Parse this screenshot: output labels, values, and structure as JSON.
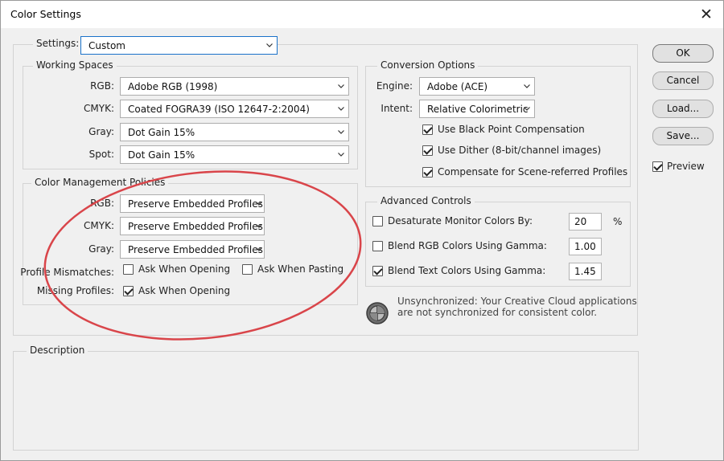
{
  "window": {
    "title": "Color Settings",
    "close_glyph": "✕"
  },
  "settings": {
    "label": "Settings:",
    "value": "Custom"
  },
  "working_spaces": {
    "title": "Working Spaces",
    "rows": [
      {
        "label": "RGB:",
        "value": "Adobe RGB (1998)"
      },
      {
        "label": "CMYK:",
        "value": "Coated FOGRA39 (ISO 12647-2:2004)"
      },
      {
        "label": "Gray:",
        "value": "Dot Gain 15%"
      },
      {
        "label": "Spot:",
        "value": "Dot Gain 15%"
      }
    ]
  },
  "policies": {
    "title": "Color Management Policies",
    "rows": [
      {
        "label": "RGB:",
        "value": "Preserve Embedded Profiles"
      },
      {
        "label": "CMYK:",
        "value": "Preserve Embedded Profiles"
      },
      {
        "label": "Gray:",
        "value": "Preserve Embedded Profiles"
      }
    ],
    "mismatch_label": "Profile Mismatches:",
    "ask_opening": {
      "label": "Ask When Opening",
      "checked": false
    },
    "ask_pasting": {
      "label": "Ask When Pasting",
      "checked": false
    },
    "missing_label": "Missing Profiles:",
    "missing_ask_opening": {
      "label": "Ask When Opening",
      "checked": true
    }
  },
  "conversion": {
    "title": "Conversion Options",
    "engine_label": "Engine:",
    "engine_value": "Adobe (ACE)",
    "intent_label": "Intent:",
    "intent_value": "Relative Colorimetric",
    "checks": [
      {
        "label": "Use Black Point Compensation",
        "checked": true
      },
      {
        "label": "Use Dither (8-bit/channel images)",
        "checked": true
      },
      {
        "label": "Compensate for Scene-referred Profiles",
        "checked": true
      }
    ]
  },
  "advanced": {
    "title": "Advanced Controls",
    "rows": [
      {
        "label": "Desaturate Monitor Colors By:",
        "value": "20",
        "unit": "%",
        "checked": false
      },
      {
        "label": "Blend RGB Colors Using Gamma:",
        "value": "1.00",
        "checked": false
      },
      {
        "label": "Blend Text Colors Using Gamma:",
        "value": "1.45",
        "checked": true
      }
    ]
  },
  "sync_note": {
    "line1": "Unsynchronized: Your Creative Cloud applications",
    "line2": "are not synchronized for consistent color.",
    "icon": "color-sync-icon"
  },
  "description": {
    "title": "Description"
  },
  "buttons": {
    "ok": "OK",
    "cancel": "Cancel",
    "load": "Load...",
    "save": "Save..."
  },
  "preview": {
    "label": "Preview",
    "checked": true
  },
  "annotation": {
    "color": "#d9454a"
  }
}
